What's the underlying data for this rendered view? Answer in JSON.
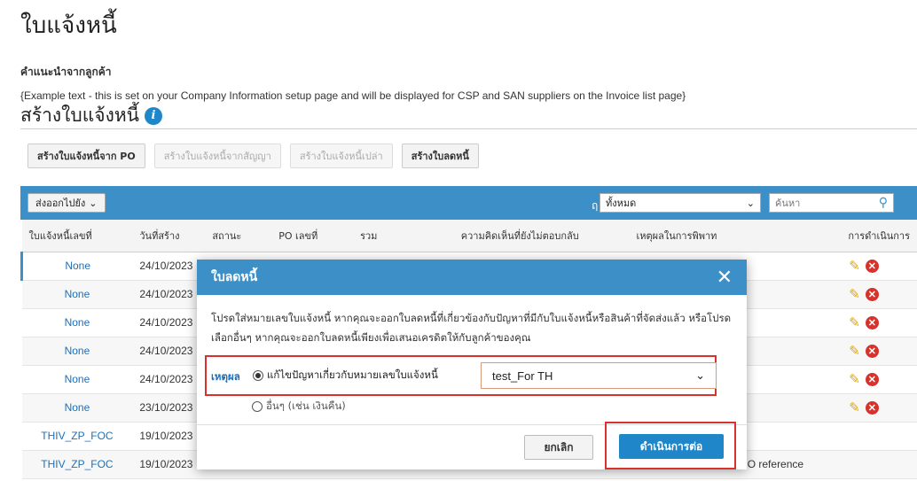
{
  "page": {
    "title": "ใบแจ้งหนี้",
    "customer_note_label": "คำแนะนำจากลูกค้า",
    "example_text": "{Example text - this is set on your Company Information setup page and will be displayed for CSP and SAN suppliers on the Invoice list page}",
    "create_title": "สร้างใบแจ้งหนี้",
    "info_icon": "i"
  },
  "actions": {
    "from_po": "สร้างใบแจ้งหนี้จาก PO",
    "from_contract": "สร้างใบแจ้งหนี้จากสัญญา",
    "blank": "สร้างใบแจ้งหนี้เปล่า",
    "credit_memo": "สร้างใบลดหนี้"
  },
  "toolbar": {
    "export_label": "ส่งออกไปยัง",
    "filter_value": "ทั้งหมด",
    "search_placeholder": "ค้นหา"
  },
  "table": {
    "headers": [
      "ใบแจ้งหนี้เลขที่",
      "วันที่สร้าง",
      "สถานะ",
      "PO เลขที่",
      "รวม",
      "ความคิดเห็นที่ยังไม่ตอบกลับ",
      "เหตุผลในการพิพาท",
      "การดำเนินการ"
    ],
    "rows": [
      {
        "invoice": "None",
        "date": "24/10/2023",
        "extra": ""
      },
      {
        "invoice": "None",
        "date": "24/10/2023",
        "extra": ""
      },
      {
        "invoice": "None",
        "date": "24/10/2023",
        "extra": ""
      },
      {
        "invoice": "None",
        "date": "24/10/2023",
        "extra": ""
      },
      {
        "invoice": "None",
        "date": "24/10/2023",
        "extra": ""
      },
      {
        "invoice": "None",
        "date": "23/10/2023",
        "extra": ""
      },
      {
        "invoice": "THIV_ZP_FOC",
        "date": "19/10/2023",
        "extra": ""
      },
      {
        "invoice": "THIV_ZP_FOC",
        "date": "19/10/2023",
        "extra": "O reference"
      }
    ]
  },
  "modal": {
    "title": "ใบลดหนี้",
    "close_icon": "✕",
    "body": "โปรดใส่หมายเลขใบแจ้งหนี้ หากคุณจะออกใบลดหนี้ที่เกี่ยวข้องกับปัญหาที่มีกับใบแจ้งหนี้หรือสินค้าที่จัดส่งแล้ว หรือโปรดเลือกอื่นๆ หากคุณจะออกใบลดหนี้เพียงเพื่อเสนอเครดิตให้กับลูกค้าของคุณ",
    "reason_label": "เหตุผล",
    "option1": "แก้ไขปัญหาเกี่ยวกับหมายเลขใบแจ้งหนี้",
    "option2": "อื่นๆ (เช่น เงินคืน)",
    "selected_invoice": "test_For TH",
    "cancel": "ยกเลิก",
    "proceed": "ดำเนินการต่อ"
  }
}
